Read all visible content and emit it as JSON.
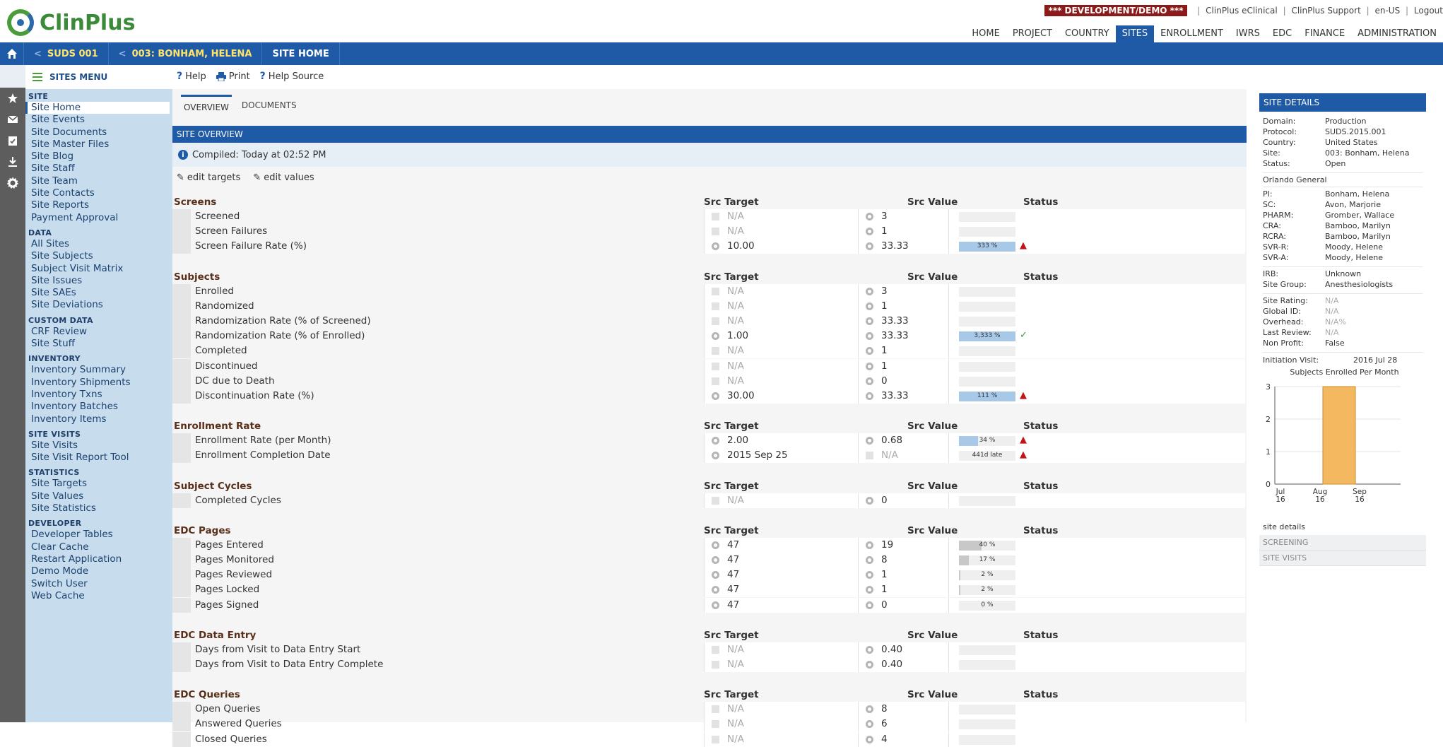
{
  "app": {
    "logo_text": "ClinPlus",
    "dev_badge": "*** DEVELOPMENT/DEMO ***",
    "util_links": [
      "ClinPlus eClinical",
      "ClinPlus Support",
      "en-US",
      "Logout"
    ]
  },
  "nav": [
    "HOME",
    "PROJECT",
    "COUNTRY",
    "SITES",
    "ENROLLMENT",
    "IWRS",
    "EDC",
    "FINANCE",
    "ADMINISTRATION"
  ],
  "nav_active": "SITES",
  "breadcrumb": {
    "study": "SUDS 001",
    "site": "003: BONHAM, HELENA",
    "page": "SITE HOME"
  },
  "menu": {
    "title": "SITES MENU",
    "sections": [
      {
        "title": "SITE",
        "items": [
          "Site Home",
          "Site Events",
          "Site Documents",
          "Site Master Files",
          "Site Blog",
          "Site Staff",
          "Site Team",
          "Site Contacts",
          "Site Reports",
          "Payment Approval"
        ]
      },
      {
        "title": "DATA",
        "items": [
          "All Sites",
          "Site Subjects",
          "Subject Visit Matrix",
          "Site Issues",
          "Site SAEs",
          "Site Deviations"
        ]
      },
      {
        "title": "CUSTOM DATA",
        "items": [
          "CRF Review",
          "Site Stuff"
        ]
      },
      {
        "title": "INVENTORY",
        "items": [
          "Inventory Summary",
          "Inventory Shipments",
          "Inventory Txns",
          "Inventory Batches",
          "Inventory Items"
        ]
      },
      {
        "title": "SITE VISITS",
        "items": [
          "Site Visits",
          "Site Visit Report Tool"
        ]
      },
      {
        "title": "STATISTICS",
        "items": [
          "Site Targets",
          "Site Values",
          "Site Statistics"
        ]
      },
      {
        "title": "DEVELOPER",
        "items": [
          "Developer Tables",
          "Clear Cache",
          "Restart Application",
          "Demo Mode",
          "Switch User",
          "Web Cache"
        ]
      }
    ]
  },
  "toolbar": {
    "help": "Help",
    "print": "Print",
    "help_source": "Help Source"
  },
  "tabs": [
    "OVERVIEW",
    "DOCUMENTS"
  ],
  "overview": {
    "header": "SITE OVERVIEW",
    "compiled": "Compiled: Today at 02:52 PM",
    "edit_targets": "edit targets",
    "edit_values": "edit values",
    "col_target": "Src Target",
    "col_value": "Src Value",
    "col_status": "Status"
  },
  "sections": [
    {
      "title": "Screens",
      "rows": [
        {
          "label": "Screened",
          "target": "N/A",
          "t_src": "none",
          "value": "3",
          "v_src": "gear",
          "bar": null
        },
        {
          "label": "Screen Failures",
          "target": "N/A",
          "t_src": "none",
          "value": "1",
          "v_src": "gear",
          "bar": null
        },
        {
          "label": "Screen Failure Rate (%)",
          "target": "10.00",
          "t_src": "gear",
          "value": "33.33",
          "v_src": "gear",
          "bar": {
            "text": "333 %",
            "pct": 1.0,
            "style": "blue",
            "ind": "up"
          }
        }
      ]
    },
    {
      "title": "Subjects",
      "rows": [
        {
          "label": "Enrolled",
          "target": "N/A",
          "t_src": "none",
          "value": "3",
          "v_src": "gear",
          "bar": null
        },
        {
          "label": "Randomized",
          "target": "N/A",
          "t_src": "none",
          "value": "1",
          "v_src": "gear",
          "bar": null
        },
        {
          "label": "Randomization Rate (% of Screened)",
          "target": "N/A",
          "t_src": "none",
          "value": "33.33",
          "v_src": "gear",
          "bar": null
        },
        {
          "label": "Randomization Rate (% of Enrolled)",
          "target": "1.00",
          "t_src": "gear",
          "value": "33.33",
          "v_src": "gear",
          "bar": {
            "text": "3,333 %",
            "pct": 1.0,
            "style": "blue",
            "ind": "ok"
          }
        },
        {
          "label": "Completed",
          "target": "N/A",
          "t_src": "none",
          "value": "1",
          "v_src": "gear",
          "bar": null
        },
        {
          "label": "Discontinued",
          "target": "N/A",
          "t_src": "none",
          "value": "1",
          "v_src": "gear",
          "bar": null
        },
        {
          "label": "DC due to Death",
          "target": "N/A",
          "t_src": "none",
          "value": "0",
          "v_src": "gear",
          "bar": null
        },
        {
          "label": "Discontinuation Rate (%)",
          "target": "30.00",
          "t_src": "gear",
          "value": "33.33",
          "v_src": "gear",
          "bar": {
            "text": "111 %",
            "pct": 1.0,
            "style": "blue",
            "ind": "up"
          }
        }
      ]
    },
    {
      "title": "Enrollment Rate",
      "rows": [
        {
          "label": "Enrollment Rate (per Month)",
          "target": "2.00",
          "t_src": "gear",
          "value": "0.68",
          "v_src": "gear",
          "bar": {
            "text": "34 %",
            "pct": 0.34,
            "style": "blue",
            "ind": "up"
          }
        },
        {
          "label": "Enrollment Completion Date",
          "target": "2015 Sep 25",
          "t_src": "gear",
          "value": "N/A",
          "v_src": "none",
          "bar": {
            "text": "441d late",
            "pct": 0,
            "style": "blue",
            "ind": "up"
          }
        }
      ]
    },
    {
      "title": "Subject Cycles",
      "rows": [
        {
          "label": "Completed Cycles",
          "target": "N/A",
          "t_src": "none",
          "value": "0",
          "v_src": "gear",
          "bar": null
        }
      ]
    },
    {
      "title": "EDC Pages",
      "rows": [
        {
          "label": "Pages Entered",
          "target": "47",
          "t_src": "gear",
          "value": "19",
          "v_src": "gear",
          "bar": {
            "text": "40 %",
            "pct": 0.4,
            "style": "grey",
            "ind": ""
          }
        },
        {
          "label": "Pages Monitored",
          "target": "47",
          "t_src": "gear",
          "value": "8",
          "v_src": "gear",
          "bar": {
            "text": "17 %",
            "pct": 0.17,
            "style": "grey",
            "ind": ""
          }
        },
        {
          "label": "Pages Reviewed",
          "target": "47",
          "t_src": "gear",
          "value": "1",
          "v_src": "gear",
          "bar": {
            "text": "2 %",
            "pct": 0.02,
            "style": "grey",
            "ind": ""
          }
        },
        {
          "label": "Pages Locked",
          "target": "47",
          "t_src": "gear",
          "value": "1",
          "v_src": "gear",
          "bar": {
            "text": "2 %",
            "pct": 0.02,
            "style": "grey",
            "ind": ""
          }
        },
        {
          "label": "Pages Signed",
          "target": "47",
          "t_src": "gear",
          "value": "0",
          "v_src": "gear",
          "bar": {
            "text": "0 %",
            "pct": 0,
            "style": "grey",
            "ind": ""
          }
        }
      ]
    },
    {
      "title": "EDC Data Entry",
      "rows": [
        {
          "label": "Days from Visit to Data Entry Start",
          "target": "N/A",
          "t_src": "none",
          "value": "0.40",
          "v_src": "gear",
          "bar": null
        },
        {
          "label": "Days from Visit to Data Entry Complete",
          "target": "N/A",
          "t_src": "none",
          "value": "0.40",
          "v_src": "gear",
          "bar": null
        }
      ]
    },
    {
      "title": "EDC Queries",
      "rows": [
        {
          "label": "Open Queries",
          "target": "N/A",
          "t_src": "none",
          "value": "8",
          "v_src": "gear",
          "bar": null
        },
        {
          "label": "Answered Queries",
          "target": "N/A",
          "t_src": "none",
          "value": "6",
          "v_src": "gear",
          "bar": null
        },
        {
          "label": "Closed Queries",
          "target": "N/A",
          "t_src": "none",
          "value": "4",
          "v_src": "gear",
          "bar": null
        }
      ]
    }
  ],
  "site_details": {
    "header": "SITE DETAILS",
    "group1": [
      {
        "k": "Domain:",
        "v": "Production"
      },
      {
        "k": "Protocol:",
        "v": "SUDS.2015.001"
      },
      {
        "k": "Country:",
        "v": "United States"
      },
      {
        "k": "Site:",
        "v": "003: Bonham, Helena"
      },
      {
        "k": "Status:",
        "v": "Open"
      }
    ],
    "org": "Orlando General",
    "group2": [
      {
        "k": "PI:",
        "v": "Bonham, Helena"
      },
      {
        "k": "SC:",
        "v": "Avon, Marjorie"
      },
      {
        "k": "PHARM:",
        "v": "Gromber, Wallace"
      },
      {
        "k": "CRA:",
        "v": "Bamboo, Marilyn"
      },
      {
        "k": "RCRA:",
        "v": "Bamboo, Marilyn"
      },
      {
        "k": "SVR-R:",
        "v": "Moody, Helene"
      },
      {
        "k": "SVR-A:",
        "v": "Moody, Helene"
      }
    ],
    "group3": [
      {
        "k": "IRB:",
        "v": "Unknown"
      },
      {
        "k": "Site Group:",
        "v": "Anesthesiologists"
      }
    ],
    "group4": [
      {
        "k": "Site Rating:",
        "v": "N/A"
      },
      {
        "k": "Global ID:",
        "v": "N/A"
      },
      {
        "k": "Overhead:",
        "v": "N/A%"
      },
      {
        "k": "Last Review:",
        "v": "N/A"
      },
      {
        "k": "Non Profit:",
        "v": "False"
      }
    ],
    "initiation_label": "Initiation Visit:",
    "initiation_value": "2016 Jul 28",
    "chart_title": "Subjects Enrolled Per Month",
    "links": {
      "details": "site details",
      "screening": "SCREENING",
      "visits": "SITE VISITS"
    }
  },
  "chart_data": {
    "type": "bar",
    "title": "Subjects Enrolled Per Month",
    "categories": [
      "Jul\n16",
      "Aug\n16",
      "Sep\n16"
    ],
    "values": [
      0,
      3,
      0
    ],
    "ylim": [
      0,
      3
    ],
    "yticks": [
      0,
      1,
      2,
      3
    ],
    "color": "#f4b860"
  },
  "colors": {
    "brand_blue": "#1f5aa6",
    "menu_bg": "#c7dced",
    "bar_blue": "#a8c8e8",
    "alert_red": "#c0161a",
    "ok_green": "#3a9a3a"
  }
}
